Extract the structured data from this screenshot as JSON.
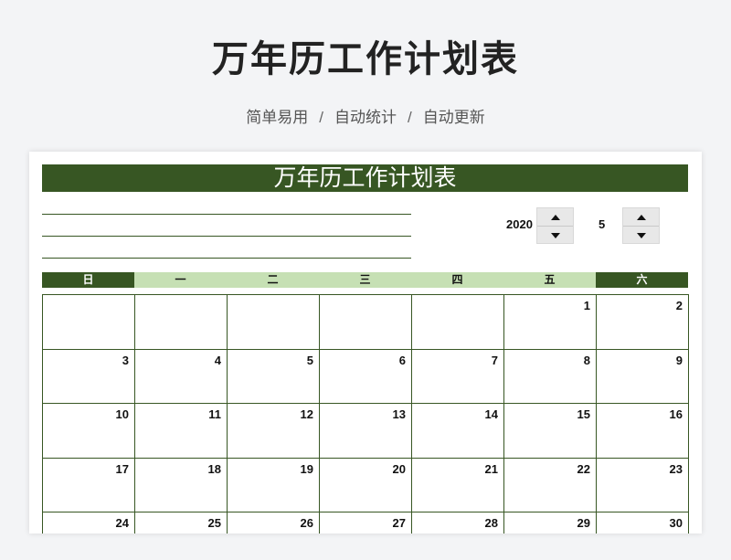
{
  "header": {
    "title": "万年历工作计划表",
    "subtitle_parts": [
      "简单易用",
      "自动统计",
      "自动更新"
    ],
    "separator": "/"
  },
  "sheet": {
    "banner_title": "万年历工作计划表",
    "year": "2020",
    "month": "5",
    "weekdays": [
      "日",
      "一",
      "二",
      "三",
      "四",
      "五",
      "六"
    ],
    "weeks": [
      [
        "",
        "",
        "",
        "",
        "",
        "1",
        "2"
      ],
      [
        "3",
        "4",
        "5",
        "6",
        "7",
        "8",
        "9"
      ],
      [
        "10",
        "11",
        "12",
        "13",
        "14",
        "15",
        "16"
      ],
      [
        "17",
        "18",
        "19",
        "20",
        "21",
        "22",
        "23"
      ],
      [
        "24",
        "25",
        "26",
        "27",
        "28",
        "29",
        "30"
      ]
    ]
  },
  "colors": {
    "accent_dark": "#375623",
    "accent_light": "#c6e0b4"
  },
  "icons": {
    "spin_up": "arrow-up-icon",
    "spin_down": "arrow-down-icon"
  }
}
